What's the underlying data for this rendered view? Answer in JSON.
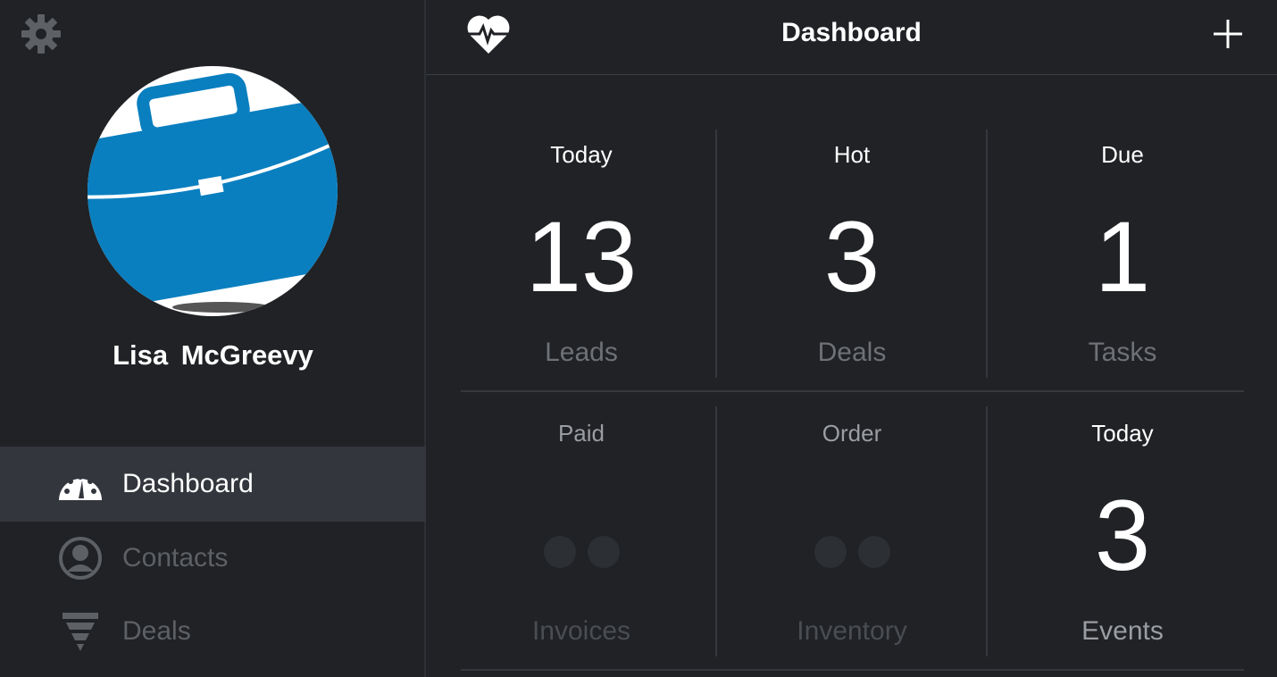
{
  "sidebar": {
    "settings_icon": "gear-icon",
    "avatar_icon": "briefcase-icon",
    "user_name": "Lisa  McGreevy",
    "items": [
      {
        "label": "Dashboard",
        "icon": "speedometer-icon",
        "active": true
      },
      {
        "label": "Contacts",
        "icon": "user-circle-icon",
        "active": false
      },
      {
        "label": "Deals",
        "icon": "funnel-icon",
        "active": false
      }
    ]
  },
  "header": {
    "title": "Dashboard",
    "left_icon": "heart-pulse-icon",
    "right_icon": "plus-icon"
  },
  "tiles": [
    {
      "top": "Today",
      "value": "13",
      "bottom": "Leads"
    },
    {
      "top": "Hot",
      "value": "3",
      "bottom": "Deals"
    },
    {
      "top": "Due",
      "value": "1",
      "bottom": "Tasks"
    },
    {
      "top": "Paid",
      "value": "",
      "bottom": "Invoices",
      "loading": true
    },
    {
      "top": "Order",
      "value": "",
      "bottom": "Inventory",
      "loading": true
    },
    {
      "top": "Today",
      "value": "3",
      "bottom": "Events"
    }
  ],
  "colors": {
    "background": "#202225",
    "active_nav": "#33363d",
    "briefcase_blue": "#0a7fbf",
    "text_white": "#ffffff",
    "text_dim": "#6e7176"
  }
}
